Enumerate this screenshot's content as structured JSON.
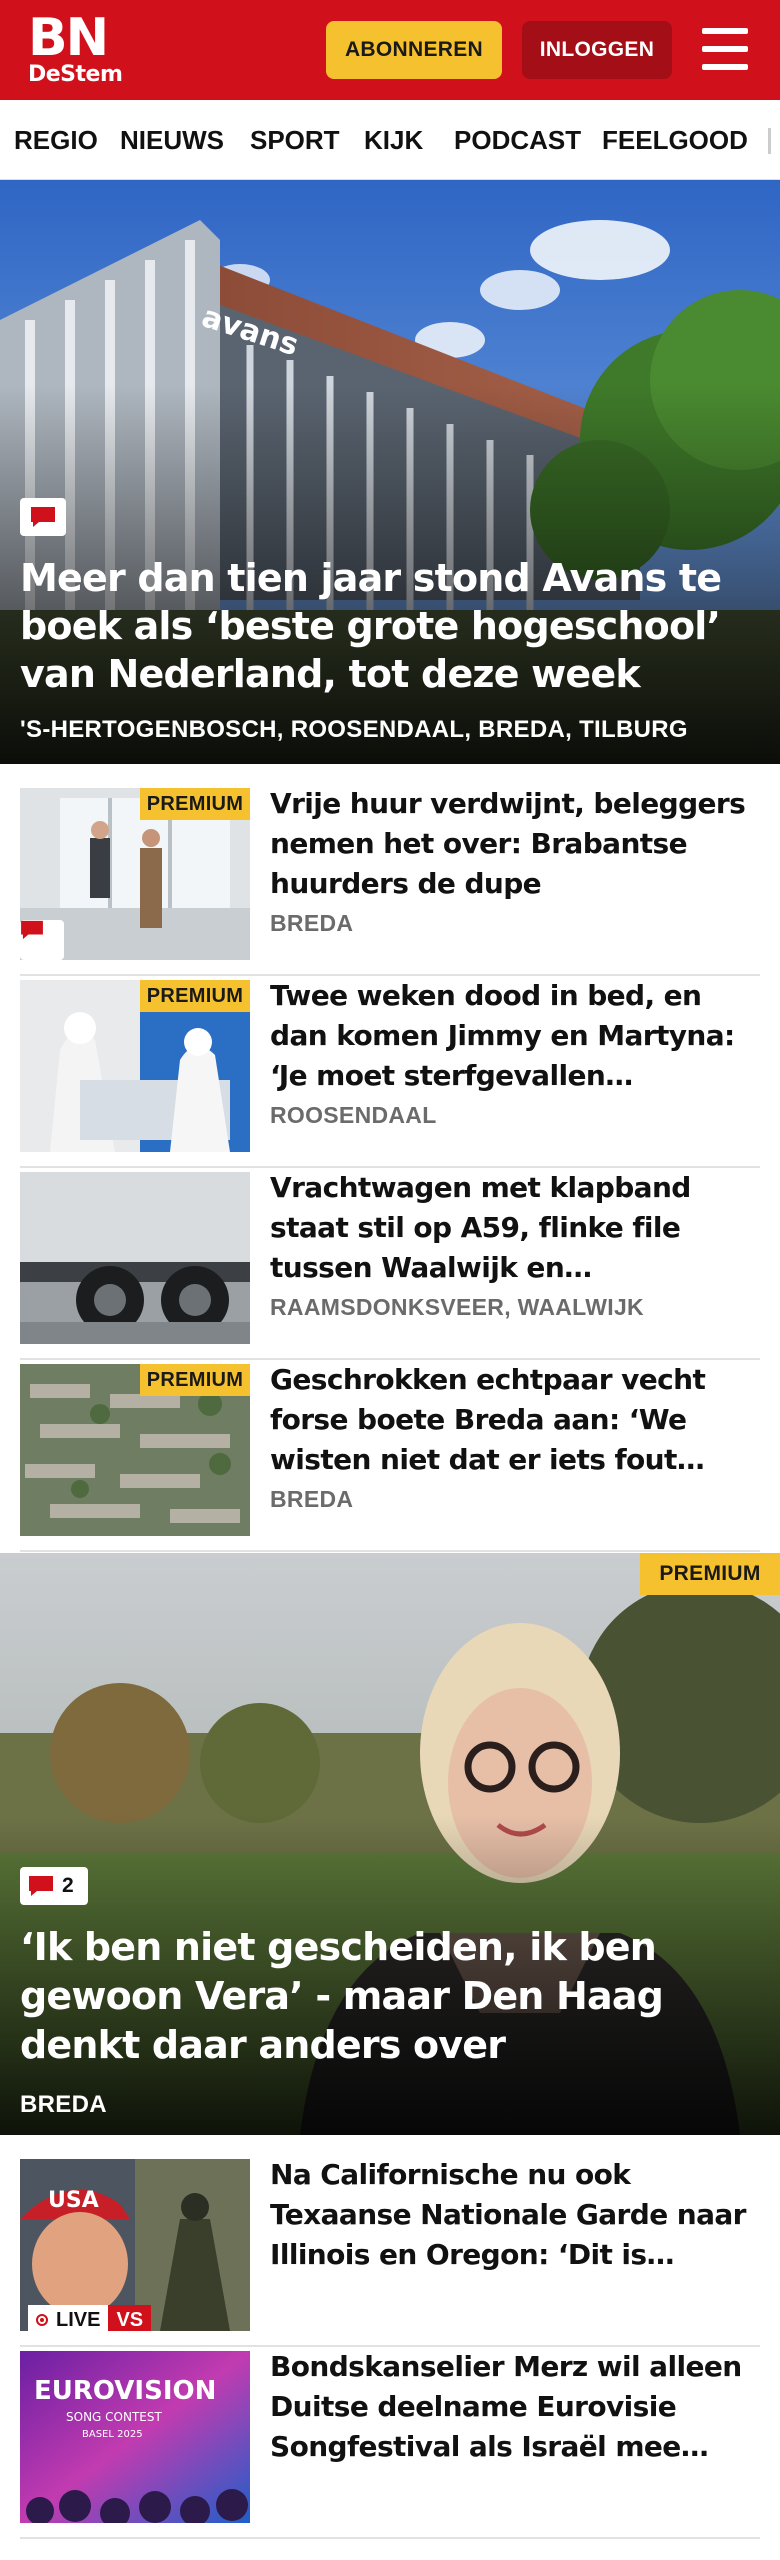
{
  "header": {
    "logo_main": "BN",
    "logo_sub": "DeStem",
    "subscribe_label": "ABONNEREN",
    "login_label": "INLOGGEN",
    "brand_color": "#d0111b",
    "accent_color": "#f5c12e"
  },
  "nav": {
    "tabs": [
      "REGIO",
      "NIEUWS",
      "SPORT",
      "KIJK",
      "PODCAST",
      "FEELGOOD"
    ]
  },
  "hero": {
    "title": "Meer dan tien jaar stond Avans te boek als ‘beste grote hogeschool’ van Nederland, tot deze week",
    "location": "'S-HERTOGENBOSCH, ROOSENDAAL, BREDA, TILBURG",
    "building_sign": "avans",
    "icon": "comment-icon"
  },
  "articles": [
    {
      "premium": "PREMIUM",
      "title": "Vrije huur verdwijnt, beleggers nemen het over: Brabantse huurders de dupe",
      "location": "BREDA"
    },
    {
      "premium": "PREMIUM",
      "title": "Twee weken dood in bed, en dan komen Jimmy en Martyna: ‘Je moet sterfgevallen kunnen…",
      "location": "ROOSENDAAL"
    },
    {
      "title": "Vrachtwagen met klapband staat stil op A59, flinke file tussen Waalwijk en knooppunt…",
      "location": "RAAMSDONKSVEER, WAALWIJK"
    },
    {
      "premium": "PREMIUM",
      "title": "Geschrokken echtpaar vecht forse boete Breda aan: ‘We wisten niet dat er iets fout ging…",
      "location": "BREDA"
    }
  ],
  "feature": {
    "premium": "PREMIUM",
    "comment_count": "2",
    "title": "‘Ik ben niet gescheiden, ik ben gewoon Vera’ - maar Den Haag denkt daar anders over",
    "location": "BREDA"
  },
  "more_articles": [
    {
      "title": "Na Californische nu ook Texaanse Nationale Garde naar Illinois en Oregon: ‘Dit is Trump…",
      "live_label": "LIVE",
      "vs_label": "VS",
      "cap_text": "USA"
    },
    {
      "title": "Bondskanselier Merz wil alleen Duitse deelname Eurovisie Songfestival als Israël mee ma…",
      "logo_text": "EUROVISION",
      "logo_sub": "SONG CONTEST",
      "logo_city": "BASEL 2025"
    }
  ]
}
